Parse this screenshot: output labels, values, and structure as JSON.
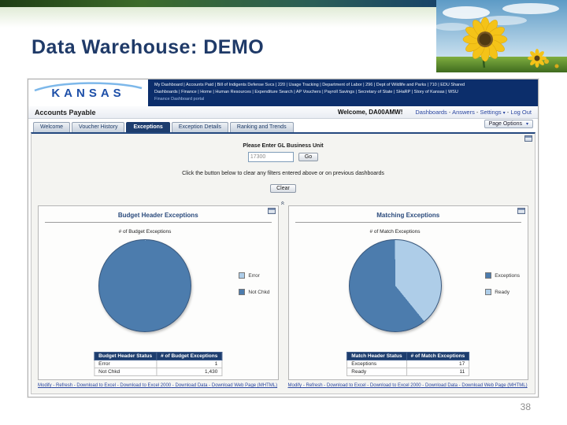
{
  "slide": {
    "title": "Data Warehouse:  DEMO",
    "page_number": "38"
  },
  "icons": {
    "caret_down": "▾",
    "collapse_chevron": "«"
  },
  "dashboard": {
    "logo_text": "KANSAS",
    "nav": {
      "row1": "My Dashboard | Accounts Paid | Bill of Indigents Defense Svcs | 220 | Usage Tracking | Department of Labor | 296 | Dept of Wildlife and Parks | 710 | EDU Shared",
      "row2": "Dashboards | Finance | Home | Human Resources | Expenditure Search | AP Vouchers | Payroll Savings | Secretary of State | SHaRP | Story of Kansas | WSU",
      "row3": "Finance Dashboard portal"
    },
    "header": {
      "title": "Accounts Payable",
      "welcome": "Welcome, DA00AMW!",
      "links": [
        "Dashboards",
        "Answers",
        "Settings",
        "Log Out"
      ],
      "page_options_label": "Page Options"
    },
    "tabs": [
      {
        "label": "Welcome"
      },
      {
        "label": "Voucher History"
      },
      {
        "label": "Exceptions"
      },
      {
        "label": "Exception Details"
      },
      {
        "label": "Ranking and Trends"
      }
    ],
    "filter": {
      "prompt": "Please Enter GL Business Unit",
      "input_value": "17300",
      "go_label": "Go",
      "clear_text": "Click the button below to clear any filters entered above or on previous dashboards",
      "clear_label": "Clear"
    },
    "panels": [
      {
        "title": "Budget Header Exceptions",
        "chart_title": "# of Budget Exceptions",
        "legend": [
          {
            "label": "Error",
            "color": "#aecde8"
          },
          {
            "label": "Not Chkd",
            "color": "#4c7cad"
          }
        ],
        "table": {
          "headers": [
            "Budget Header Status",
            "# of Budget Exceptions"
          ],
          "rows": [
            [
              "Error",
              "1"
            ],
            [
              "Not Chkd",
              "1,430"
            ]
          ]
        },
        "footer_links": [
          "Modify",
          "Refresh",
          "Download to Excel",
          "Download to Excel 2000",
          "Download Data",
          "Download Web Page (MHTML)"
        ]
      },
      {
        "title": "Matching Exceptions",
        "chart_title": "# of Match Exceptions",
        "legend": [
          {
            "label": "Exceptions",
            "color": "#4c7cad"
          },
          {
            "label": "Ready",
            "color": "#aecde8"
          }
        ],
        "table": {
          "headers": [
            "Match Header Status",
            "# of Match Exceptions"
          ],
          "rows": [
            [
              "Exceptions",
              "17"
            ],
            [
              "Ready",
              "11"
            ]
          ]
        },
        "footer_links": [
          "Modify",
          "Refresh",
          "Download to Excel",
          "Download to Excel 2000",
          "Download Data",
          "Download Web Page (MHTML)"
        ]
      }
    ]
  },
  "chart_data": [
    {
      "type": "pie",
      "title": "# of Budget Exceptions",
      "labels": [
        "Error",
        "Not Chkd"
      ],
      "values": [
        1,
        1430
      ],
      "colors": [
        "#aecde8",
        "#4c7cad"
      ],
      "rotation": 0,
      "legend_position": "right"
    },
    {
      "type": "pie",
      "title": "# of Match Exceptions",
      "labels": [
        "Exceptions",
        "Ready"
      ],
      "values": [
        17,
        11
      ],
      "colors": [
        "#4c7cad",
        "#aecde8"
      ],
      "rotation": 141,
      "legend_position": "right"
    }
  ]
}
